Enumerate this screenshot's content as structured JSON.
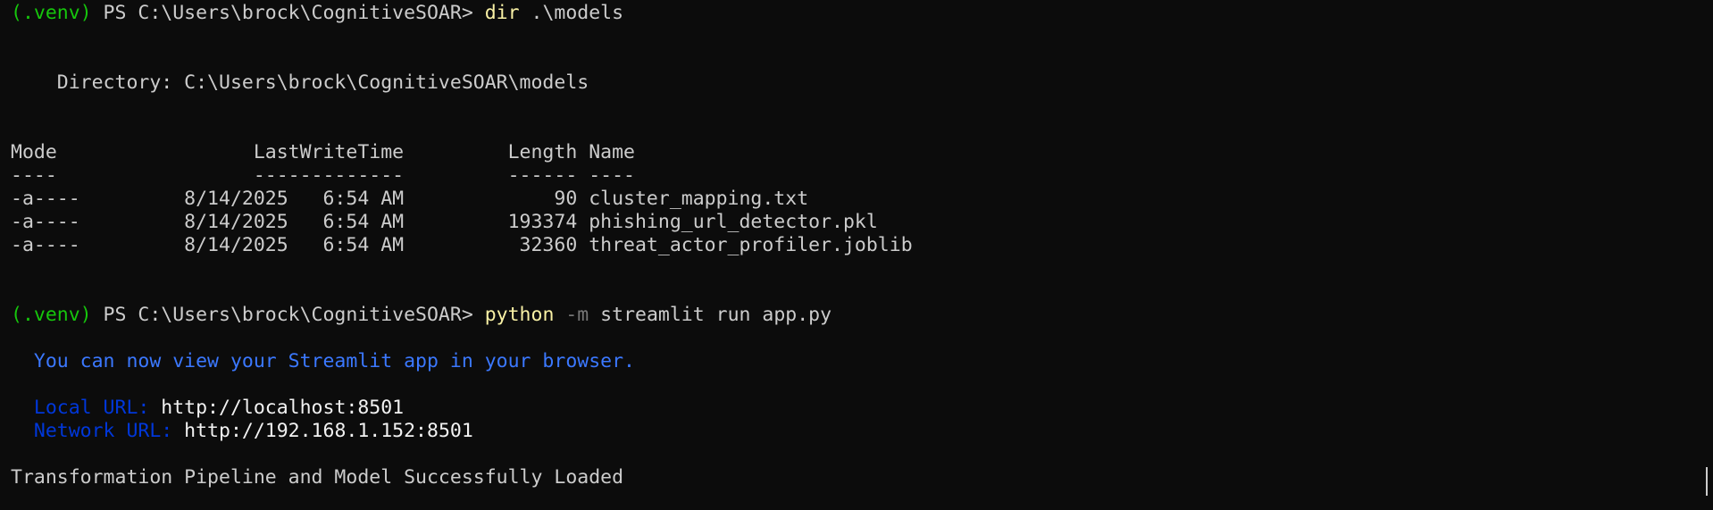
{
  "terminal": {
    "dir_command": {
      "venv": "(.venv)",
      "prompt": " PS C:\\Users\\brock\\CognitiveSOAR> ",
      "command": "dir",
      "args": " .\\models"
    },
    "directory_line": "    Directory: C:\\Users\\brock\\CognitiveSOAR\\models",
    "table": {
      "header": "Mode                 LastWriteTime         Length Name",
      "separator": "----                 -------------         ------ ----",
      "rows": [
        "-a----         8/14/2025   6:54 AM             90 cluster_mapping.txt",
        "-a----         8/14/2025   6:54 AM         193374 phishing_url_detector.pkl",
        "-a----         8/14/2025   6:54 AM          32360 threat_actor_profiler.joblib"
      ]
    },
    "run_command": {
      "venv": "(.venv)",
      "prompt": " PS C:\\Users\\brock\\CognitiveSOAR> ",
      "command": "python",
      "flag": " -m",
      "args": " streamlit run app.py"
    },
    "streamlit_info": "  You can now view your Streamlit app in your browser.",
    "local_url": {
      "label": "  Local URL: ",
      "value": "http://localhost:8501"
    },
    "network_url": {
      "label": "  Network URL: ",
      "value": "http://192.168.1.152:8501"
    },
    "status_message": "Transformation Pipeline and Model Successfully Loaded"
  }
}
